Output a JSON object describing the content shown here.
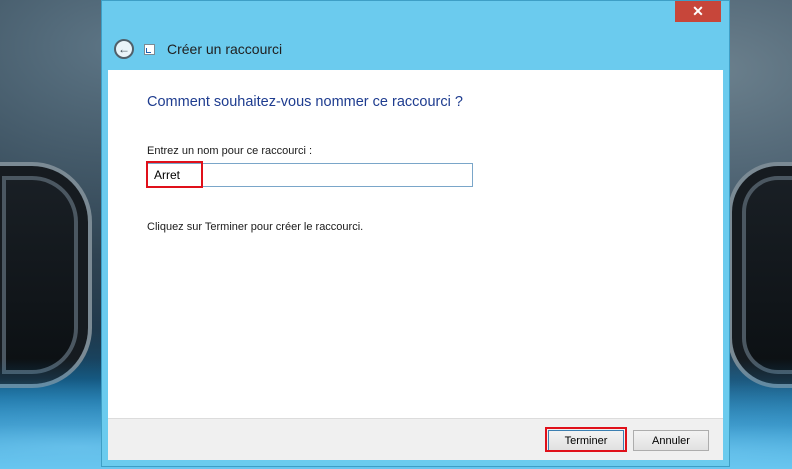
{
  "window": {
    "title": "Créer un raccourci",
    "close_label": "✕"
  },
  "content": {
    "heading": "Comment souhaitez-vous nommer ce raccourci ?",
    "field_label": "Entrez un nom pour ce raccourci :",
    "field_value": "Arret",
    "hint": "Cliquez sur Terminer pour créer le raccourci."
  },
  "footer": {
    "finish_label": "Terminer",
    "cancel_label": "Annuler"
  },
  "colors": {
    "title_bar": "#6bcbee",
    "heading": "#1e3c8f",
    "highlight": "#e0101a",
    "close_button": "#c7463a"
  },
  "icons": {
    "back": "back-arrow-icon",
    "shortcut": "shortcut-icon",
    "close": "close-icon"
  }
}
